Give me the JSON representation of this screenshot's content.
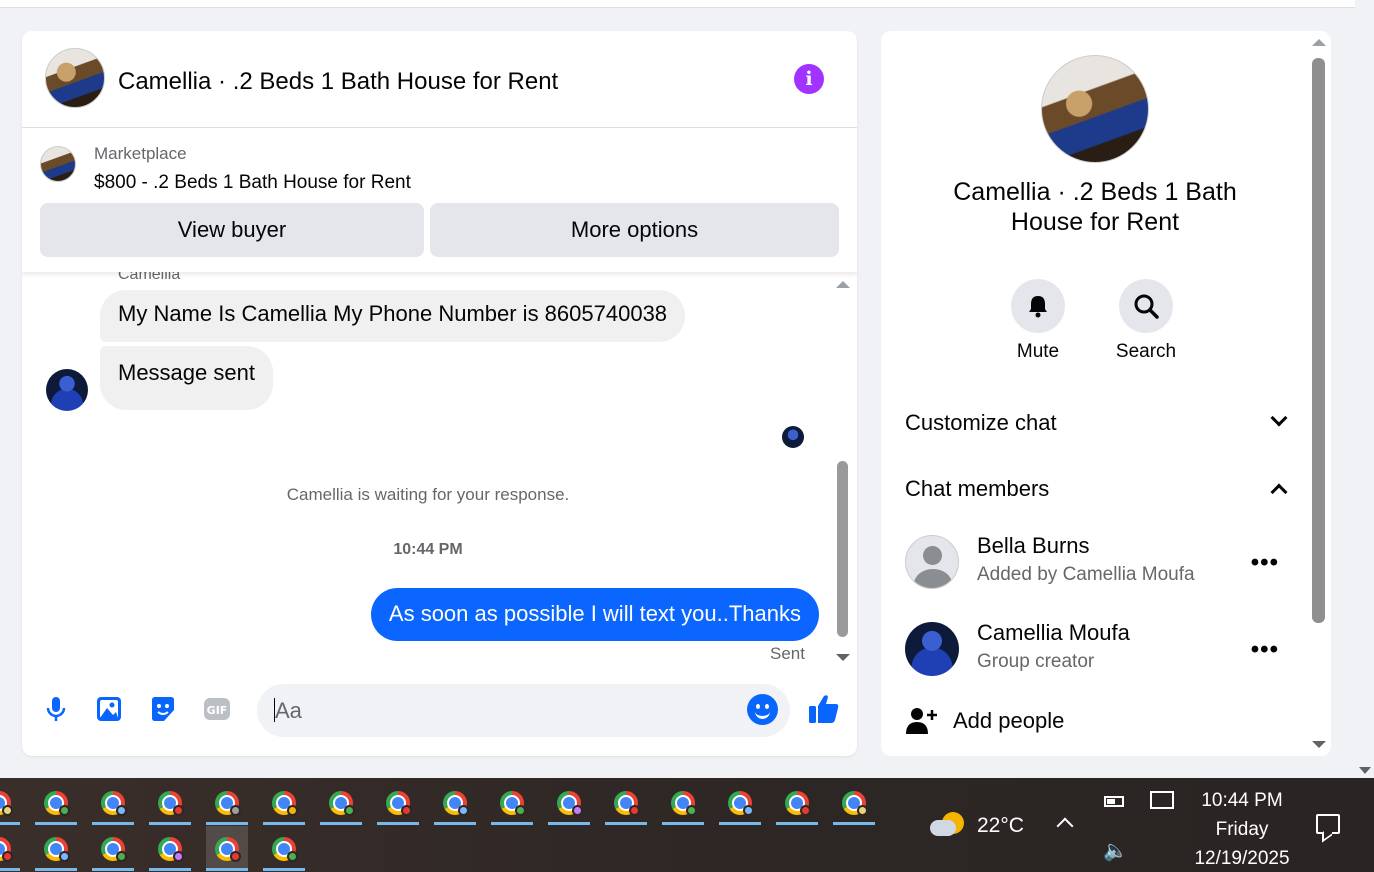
{
  "chat": {
    "title": "Camellia · .2 Beds 1 Bath House for Rent",
    "marketplace_label": "Marketplace",
    "listing": "$800 - .2 Beds 1 Bath House for Rent",
    "view_buyer_label": "View buyer",
    "more_options_label": "More options",
    "sender_name": "Camellia",
    "messages": [
      {
        "text": "My Name Is Camellia My Phone Number is 8605740038",
        "direction": "incoming"
      },
      {
        "text": "Message sent",
        "direction": "incoming"
      }
    ],
    "waiting_text": "Camellia is waiting for your response.",
    "timestamp": "10:44 PM",
    "outgoing_message": "As soon as possible I will text you..Thanks",
    "status": "Sent",
    "composer_placeholder": "Aa"
  },
  "info_panel": {
    "title": "Camellia · .2 Beds 1 Bath House for Rent",
    "actions": [
      {
        "label": "Mute",
        "icon": "bell-icon"
      },
      {
        "label": "Search",
        "icon": "search-icon"
      }
    ],
    "customize_label": "Customize chat",
    "members_label": "Chat members",
    "members": [
      {
        "name": "Bella Burns",
        "subtitle": "Added by Camellia Moufa"
      },
      {
        "name": "Camellia Moufa",
        "subtitle": "Group creator"
      }
    ],
    "add_people_label": "Add people"
  },
  "taskbar": {
    "temperature": "22°C",
    "time": "10:44 PM",
    "day": "Friday",
    "date": "12/19/2025"
  },
  "colors": {
    "accent": "#0866ff",
    "info_icon": "#a033ff",
    "bubble_in": "#f0f0f0"
  }
}
